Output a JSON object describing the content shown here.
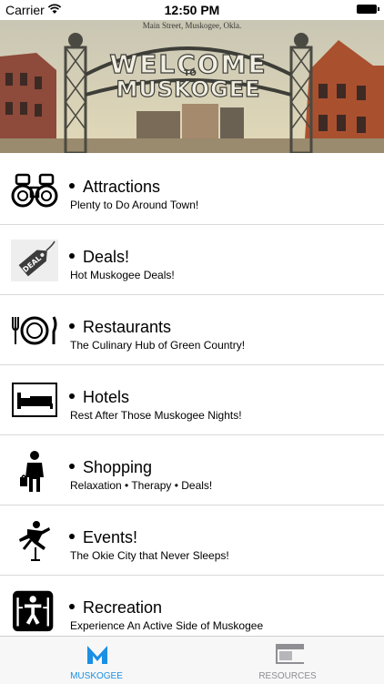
{
  "status_bar": {
    "carrier": "Carrier",
    "time": "12:50 PM"
  },
  "banner": {
    "caption": "Main Street, Muskogee, Okla.",
    "sign_top": "WELCOME",
    "sign_mid": "TO",
    "sign_bottom": "MUSKOGEE"
  },
  "menu": [
    {
      "title": "Attractions",
      "subtitle": "Plenty to Do Around Town!",
      "icon": "binoculars-icon"
    },
    {
      "title": "Deals!",
      "subtitle": "Hot Muskogee Deals!",
      "icon": "deal-tag-icon",
      "tag": "DEAL"
    },
    {
      "title": "Restaurants",
      "subtitle": "The Culinary Hub of Green Country!",
      "icon": "place-setting-icon"
    },
    {
      "title": "Hotels",
      "subtitle": "Rest After Those Muskogee Nights!",
      "icon": "bed-icon"
    },
    {
      "title": "Shopping",
      "subtitle": "Relaxation • Therapy • Deals!",
      "icon": "shopper-icon"
    },
    {
      "title": "Events!",
      "subtitle": "The Okie City that Never Sleeps!",
      "icon": "jumping-person-icon"
    },
    {
      "title": "Recreation",
      "subtitle": "Experience An Active Side of Muskogee",
      "icon": "playground-icon"
    }
  ],
  "tab_bar": {
    "tabs": [
      {
        "label": "MUSKOGEE",
        "icon": "m-logo-icon",
        "active": true
      },
      {
        "label": "RESOURCES",
        "icon": "resources-icon",
        "active": false
      }
    ],
    "colors": {
      "active": "#1a8fe3",
      "inactive": "#8e8e93"
    }
  }
}
